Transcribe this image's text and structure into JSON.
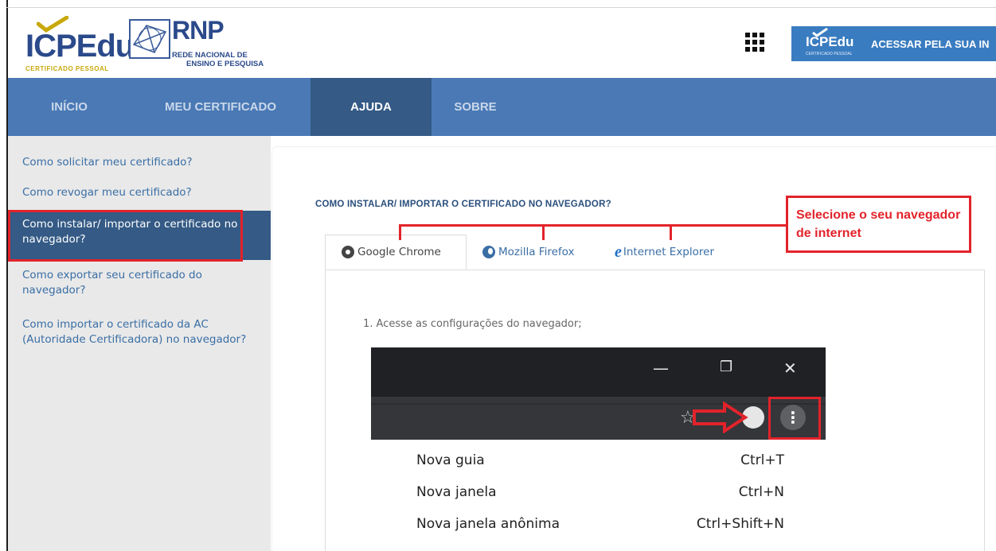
{
  "header": {
    "logo_icpedu_text": "ICPEdu",
    "logo_icpedu_sub": "CERTIFICADO PESSOAL",
    "logo_rnp_title": "RNP",
    "logo_rnp_sub1": "REDE NACIONAL DE",
    "logo_rnp_sub2": "ENSINO E PESQUISA",
    "access_logo_text": "ICPEdu",
    "access_logo_sub": "CERTIFICADO PESSOAL",
    "access_label": "ACESSAR PELA SUA IN"
  },
  "nav": {
    "items": [
      {
        "label": "INÍCIO"
      },
      {
        "label": "MEU CERTIFICADO"
      },
      {
        "label": "AJUDA"
      },
      {
        "label": "SOBRE"
      }
    ],
    "active": "AJUDA"
  },
  "sidebar": {
    "items": [
      {
        "label": "Como solicitar meu certificado?"
      },
      {
        "label": "Como revogar meu certificado?"
      },
      {
        "label": "Como instalar/ importar o certificado no navegador?"
      },
      {
        "label": "Como exportar seu certificado do navegador?"
      },
      {
        "label": "Como importar o certificado da AC (Autoridade Certificadora) no navegador?"
      }
    ],
    "active_index": 2
  },
  "content": {
    "section_title": "COMO INSTALAR/ IMPORTAR O CERTIFICADO NO NAVEGADOR?",
    "tabs": [
      {
        "label": "Google Chrome",
        "icon": "chrome-icon"
      },
      {
        "label": "Mozilla Firefox",
        "icon": "firefox-icon"
      },
      {
        "label": "Internet Explorer",
        "icon": "internet-explorer-icon"
      }
    ],
    "active_tab": "Google Chrome",
    "callout": "Selecione o seu navegador de internet",
    "step1": "1. Acesse as configurações do navegador;"
  },
  "browser_shot": {
    "window_controls": [
      "—",
      "❐",
      "✕"
    ],
    "menu": [
      {
        "label": "Nova guia",
        "shortcut": "Ctrl+T"
      },
      {
        "label": "Nova janela",
        "shortcut": "Ctrl+N"
      },
      {
        "label": "Nova janela anônima",
        "shortcut": "Ctrl+Shift+N"
      }
    ]
  },
  "colors": {
    "nav_bg": "#4a79b5",
    "nav_active": "#345a85",
    "annotation_red": "#e2232b",
    "link_blue": "#3a6ea5"
  }
}
